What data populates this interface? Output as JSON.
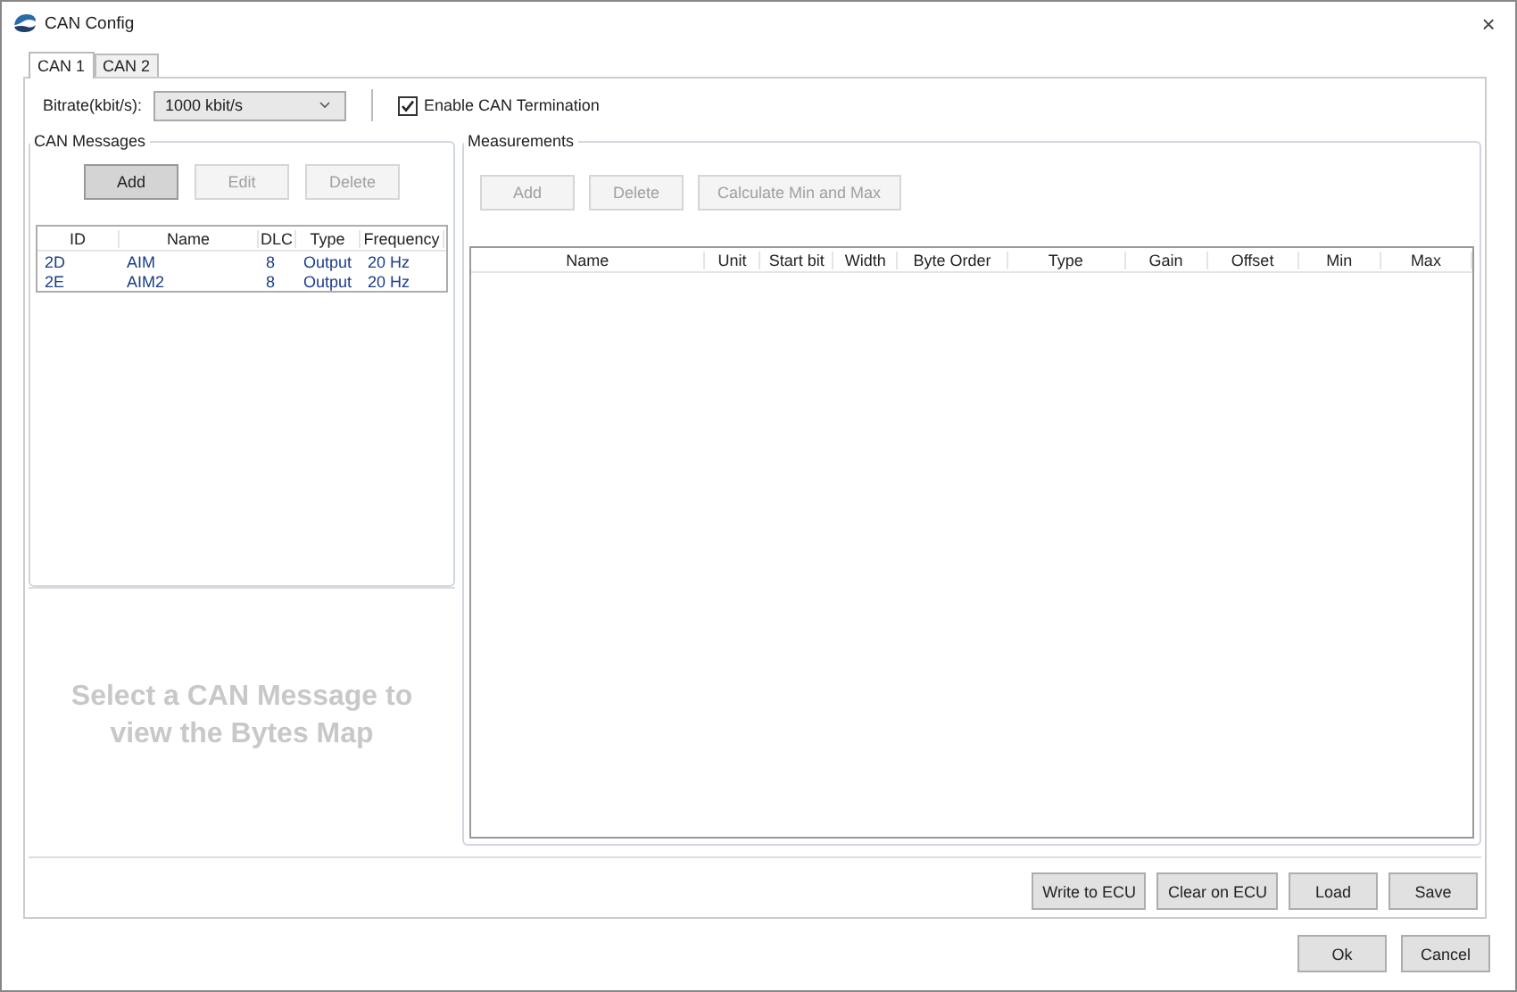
{
  "window": {
    "title": "CAN Config",
    "close": "×"
  },
  "tabs": [
    {
      "label": "CAN 1",
      "selected": true
    },
    {
      "label": "CAN 2",
      "selected": false
    }
  ],
  "bitrate": {
    "label": "Bitrate(kbit/s):",
    "value": "1000 kbit/s"
  },
  "termination": {
    "label": "Enable CAN Termination",
    "checked": true
  },
  "can_messages": {
    "title": "CAN Messages",
    "buttons": [
      {
        "label": "Add",
        "disabled": false
      },
      {
        "label": "Edit",
        "disabled": true
      },
      {
        "label": "Delete",
        "disabled": true
      }
    ],
    "columns": [
      "ID",
      "Name",
      "DLC",
      "Type",
      "Frequency"
    ],
    "rows": [
      [
        "2D",
        "AIM",
        "8",
        "Output",
        "20 Hz"
      ],
      [
        "2E",
        "AIM2",
        "8",
        "Output",
        "20 Hz"
      ]
    ],
    "bytes_map_hint": "Select a CAN Message to view the Bytes Map"
  },
  "measurements": {
    "title": "Measurements",
    "buttons": [
      {
        "label": "Add",
        "disabled": true
      },
      {
        "label": "Delete",
        "disabled": true
      },
      {
        "label": "Calculate Min and Max",
        "disabled": true
      }
    ],
    "columns": [
      "Name",
      "Unit",
      "Start bit",
      "Width",
      "Byte Order",
      "Type",
      "Gain",
      "Offset",
      "Min",
      "Max"
    ]
  },
  "action_buttons": [
    "Write to ECU",
    "Clear on ECU",
    "Load",
    "Save"
  ],
  "dialog_buttons": [
    "Ok",
    "Cancel"
  ]
}
